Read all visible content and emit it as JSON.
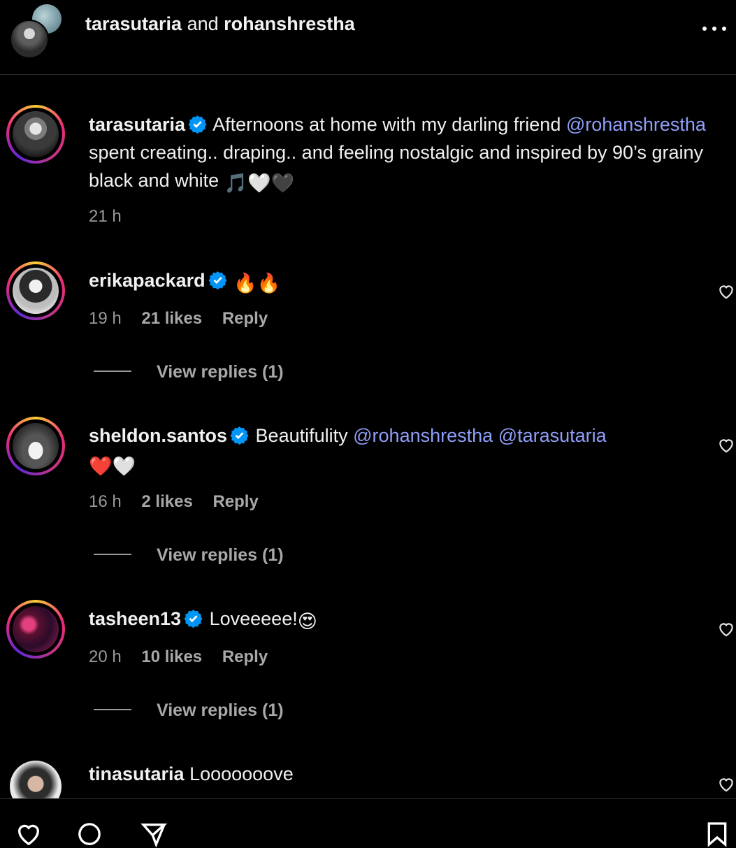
{
  "header": {
    "user1": "tarasutaria",
    "joiner": "and",
    "user2": "rohanshrestha"
  },
  "caption": {
    "username": "tarasutaria",
    "text_part1": "Afternoons at home with my darling friend",
    "mention": "@rohanshrestha",
    "text_part2": "spent creating.. draping.. and feeling nostalgic and inspired by 90’s grainy black and white",
    "emojis": "🎵🤍🖤",
    "time": "21 h"
  },
  "comments": [
    {
      "username": "erikapackard",
      "text": "",
      "emojis": "🔥🔥",
      "time": "19 h",
      "likes": "21 likes",
      "reply": "Reply",
      "view_replies": "View replies (1)"
    },
    {
      "username": "sheldon.santos",
      "text": "Beautifulity",
      "mention1": "@rohanshrestha",
      "mention2": "@tarasutaria",
      "emojis": "❤️🤍",
      "time": "16 h",
      "likes": "2 likes",
      "reply": "Reply",
      "view_replies": "View replies (1)"
    },
    {
      "username": "tasheen13",
      "text": "Loveeeee!",
      "emojis": "😍",
      "time": "20 h",
      "likes": "10 likes",
      "reply": "Reply",
      "view_replies": "View replies (1)"
    },
    {
      "username": "tinasutaria",
      "text": "Looooooove"
    }
  ],
  "colors": {
    "background": "#000000",
    "mention": "#8f9ef7",
    "verified": "#0095f6",
    "muted": "#a8a8a8"
  },
  "icons": [
    "more-options-icon",
    "verified-badge-icon",
    "heart-icon",
    "comment-icon",
    "share-icon",
    "bookmark-icon"
  ]
}
